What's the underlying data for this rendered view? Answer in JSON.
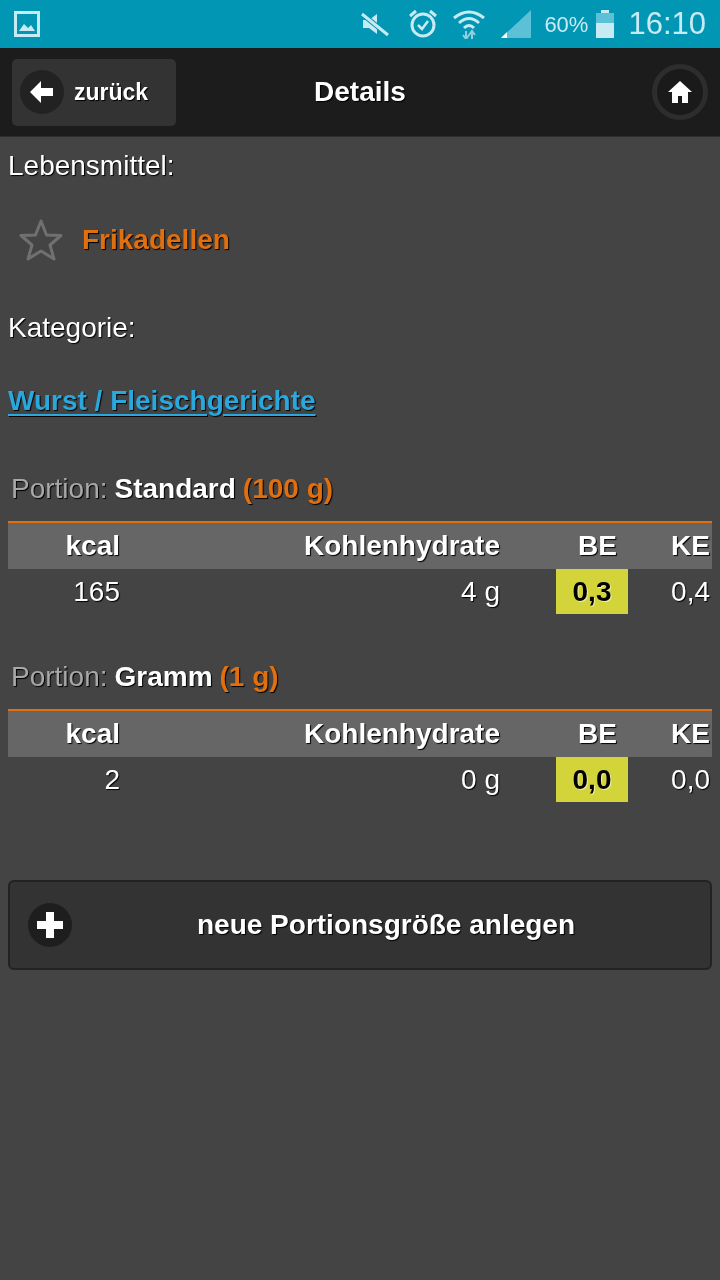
{
  "status_bar": {
    "battery": "60%",
    "time": "16:10"
  },
  "header": {
    "back_button": "zurück",
    "title": "Details"
  },
  "food": {
    "label": "Lebensmittel:",
    "name": "Frikadellen",
    "favorite": false
  },
  "category": {
    "label": "Kategorie:",
    "link": "Wurst / Fleischgerichte"
  },
  "portions": [
    {
      "prefix": "Portion:",
      "name": "Standard",
      "size": "(100 g)",
      "columns": [
        "kcal",
        "Kohlenhydrate",
        "BE",
        "KE"
      ],
      "cells": [
        {
          "text": "165",
          "highlighted": false
        },
        {
          "text": "4 g",
          "highlighted": false
        },
        {
          "text": "0,3",
          "highlighted": true
        },
        {
          "text": "0,4",
          "highlighted": false
        }
      ]
    },
    {
      "prefix": "Portion:",
      "name": "Gramm",
      "size": "(1 g)",
      "columns": [
        "kcal",
        "Kohlenhydrate",
        "BE",
        "KE"
      ],
      "cells": [
        {
          "text": "2",
          "highlighted": false
        },
        {
          "text": "0 g",
          "highlighted": false
        },
        {
          "text": "0,0",
          "highlighted": true
        },
        {
          "text": "0,0",
          "highlighted": false
        }
      ]
    }
  ],
  "add_button": {
    "label": "neue Portionsgröße anlegen"
  }
}
